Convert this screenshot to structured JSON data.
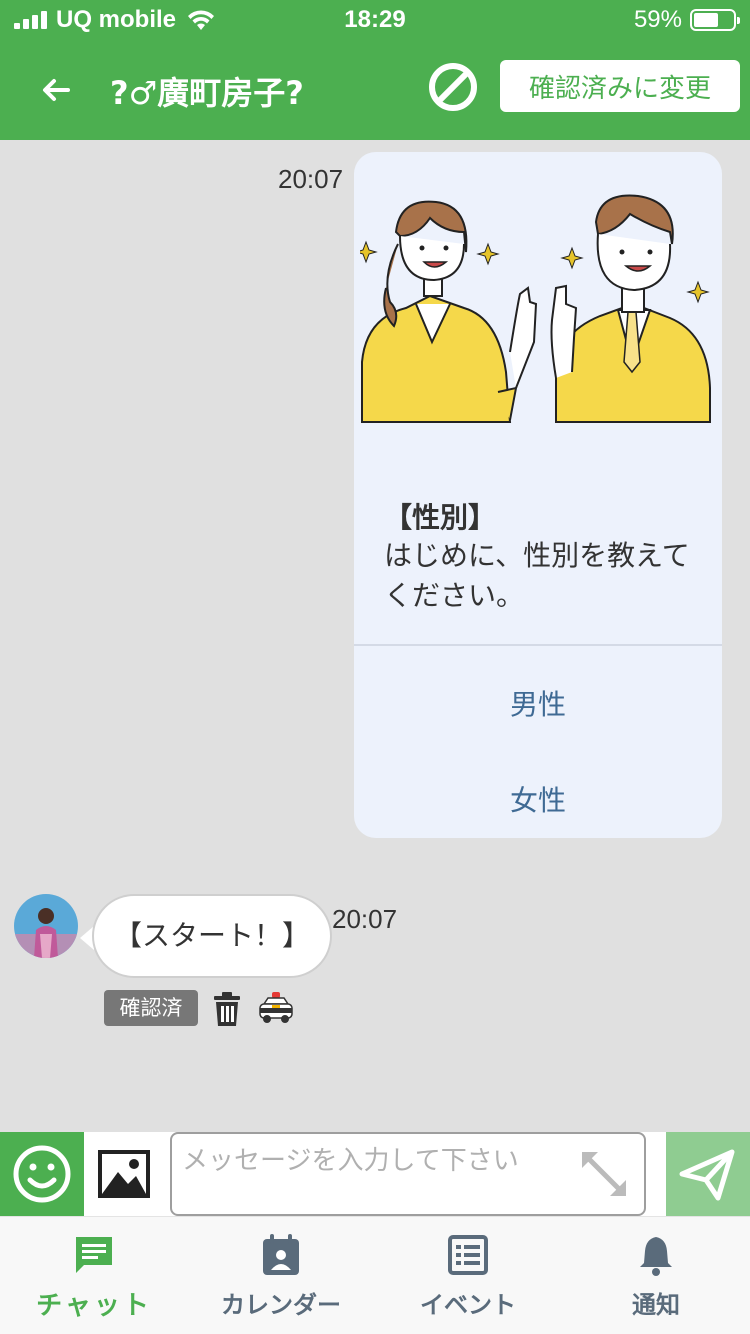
{
  "status_bar": {
    "carrier": "UQ mobile",
    "time": "18:29",
    "battery": "59%",
    "battery_level": 0.59
  },
  "header": {
    "title": "?♂廣町房子?",
    "confirm_button": "確認済みに変更",
    "icons": {
      "back": "back-arrow-icon",
      "block": "block-icon"
    }
  },
  "chat": {
    "bot_message": {
      "time": "20:07",
      "question_title": "【性別】",
      "question_text": "はじめに、性別を教えてください。",
      "options": [
        "男性",
        "女性"
      ]
    },
    "user_message": {
      "text": "【スタート！】",
      "time": "20:07",
      "status_badge": "確認済",
      "icons": [
        "trash-icon",
        "police-car-icon"
      ]
    }
  },
  "input": {
    "placeholder": "メッセージを入力して下さい",
    "value": ""
  },
  "tabs": [
    {
      "label": "チャット",
      "icon": "chat-icon",
      "active": true
    },
    {
      "label": "カレンダー",
      "icon": "calendar-icon",
      "active": false
    },
    {
      "label": "イベント",
      "icon": "event-list-icon",
      "active": false
    },
    {
      "label": "通知",
      "icon": "bell-icon",
      "active": false
    }
  ],
  "colors": {
    "primary_green": "#4caf50",
    "send_green": "#8fcc91",
    "card_bg": "#edf2fc",
    "option_text": "#3f6a94",
    "chat_bg": "#e0e0e0"
  }
}
